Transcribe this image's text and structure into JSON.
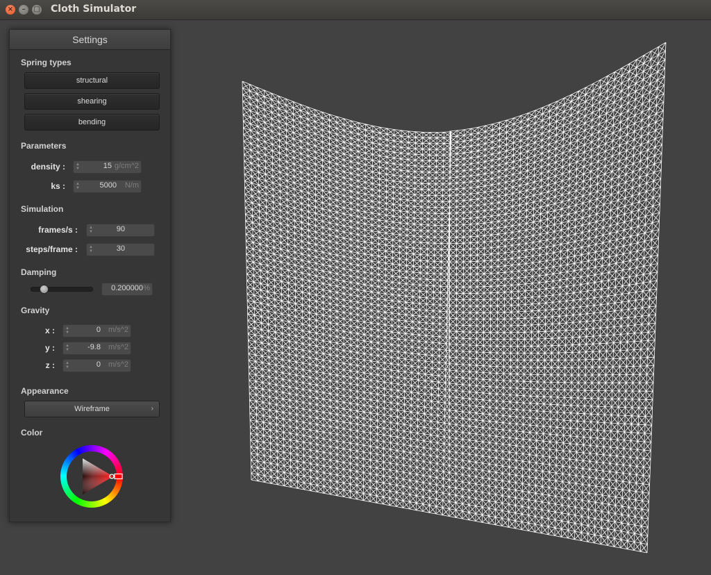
{
  "window": {
    "title": "Cloth Simulator",
    "close_glyph": "×",
    "minimize_glyph": "–",
    "maximize_glyph": "□"
  },
  "settings": {
    "header": "Settings",
    "spring_types": {
      "heading": "Spring types",
      "buttons": [
        "structural",
        "shearing",
        "bending"
      ]
    },
    "parameters": {
      "heading": "Parameters",
      "density": {
        "label": "density :",
        "value": "15",
        "unit": "g/cm^2"
      },
      "ks": {
        "label": "ks :",
        "value": "5000",
        "unit": "N/m"
      }
    },
    "simulation": {
      "heading": "Simulation",
      "fps": {
        "label": "frames/s :",
        "value": "90"
      },
      "steps": {
        "label": "steps/frame :",
        "value": "30"
      }
    },
    "damping": {
      "heading": "Damping",
      "value": "0.200000",
      "unit": "%",
      "slider_fraction": 0.2
    },
    "gravity": {
      "heading": "Gravity",
      "x": {
        "label": "x :",
        "value": "0",
        "unit": "m/s^2"
      },
      "y": {
        "label": "y :",
        "value": "-9.8",
        "unit": "m/s^2"
      },
      "z": {
        "label": "z :",
        "value": "0",
        "unit": "m/s^2"
      }
    },
    "appearance": {
      "heading": "Appearance",
      "selected": "Wireframe",
      "chevron_glyph": "›"
    },
    "color": {
      "heading": "Color",
      "selected_hue_color": "#ff0000",
      "selected_color": "#ffffff"
    }
  },
  "viewport": {
    "background": "#424242",
    "mesh_color": "#ffffff",
    "mode": "Wireframe"
  }
}
